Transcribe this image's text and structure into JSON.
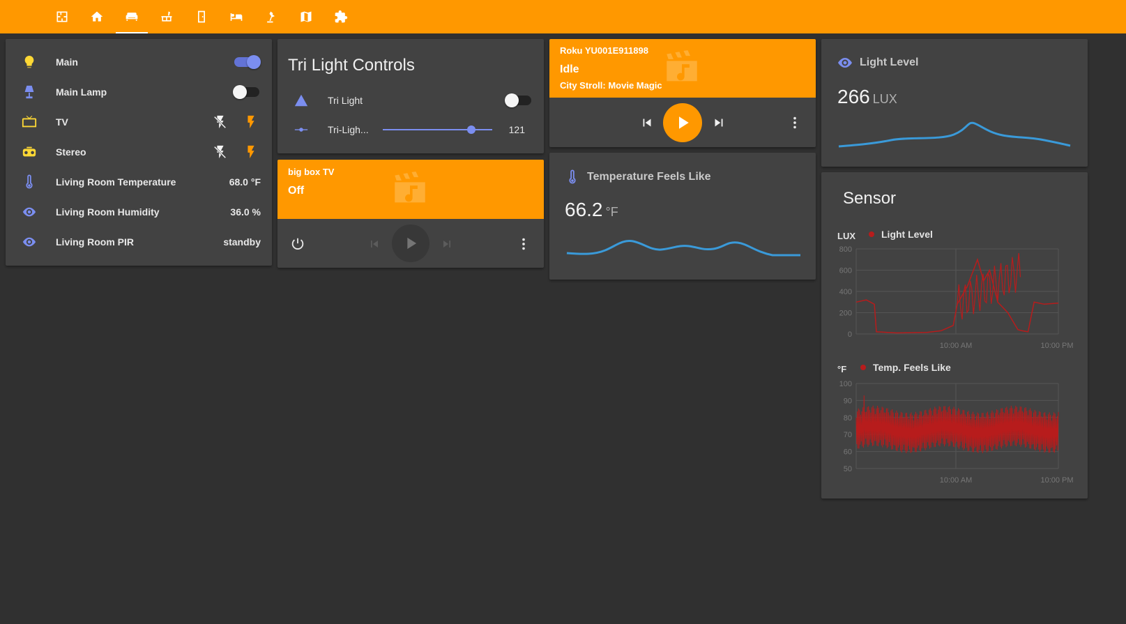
{
  "nav": {
    "tabs": [
      {
        "icon": "floorplan-icon"
      },
      {
        "icon": "home-icon"
      },
      {
        "icon": "sofa-icon",
        "active": true
      },
      {
        "icon": "kitchen-icon"
      },
      {
        "icon": "door-icon"
      },
      {
        "icon": "bed-icon"
      },
      {
        "icon": "desk-lamp-icon"
      },
      {
        "icon": "map-icon"
      },
      {
        "icon": "puzzle-icon"
      }
    ],
    "accent": "#ff9800"
  },
  "entities": {
    "rows": [
      {
        "label": "Main",
        "icon": "lightbulb-icon",
        "control": "toggle",
        "state": "on"
      },
      {
        "label": "Main Lamp",
        "icon": "lamp-icon",
        "control": "toggle",
        "state": "off"
      },
      {
        "label": "TV",
        "icon": "tv-icon",
        "control": "power-buttons"
      },
      {
        "label": "Stereo",
        "icon": "radio-icon",
        "control": "power-buttons"
      },
      {
        "label": "Living Room Temperature",
        "icon": "thermometer-icon",
        "value": "68.0 °F"
      },
      {
        "label": "Living Room Humidity",
        "icon": "eye-icon",
        "value": "36.0 %"
      },
      {
        "label": "Living Room PIR",
        "icon": "eye-icon",
        "value": "standby"
      }
    ]
  },
  "tri_light": {
    "title": "Tri Light Controls",
    "toggle_label": "Tri Light",
    "toggle_state": "off",
    "slider_label": "Tri-Ligh...",
    "slider_value": "121",
    "slider_fraction": 0.81
  },
  "big_box_tv": {
    "name": "big box TV",
    "state": "Off"
  },
  "roku": {
    "name": "Roku YU001E911898",
    "state": "Idle",
    "source": "City Stroll: Movie Magic"
  },
  "feels_like": {
    "name": "Temperature Feels Like",
    "value": "66.2",
    "unit": "°F"
  },
  "light_level": {
    "name": "Light Level",
    "value": "266",
    "unit": "LUX"
  },
  "sensor": {
    "title": "Sensor",
    "colors": {
      "series": "#b71c1c",
      "sparkline": "#3a9ad9"
    }
  },
  "chart_data": [
    {
      "type": "line",
      "unit_label": "LUX",
      "series": [
        {
          "name": "Light Level"
        }
      ],
      "ylim": [
        0,
        800
      ],
      "yticks": [
        "800",
        "600",
        "400",
        "200",
        "0"
      ],
      "xticks": [
        "10:00 AM",
        "10:00 PM"
      ],
      "x": [
        0,
        0.05,
        0.09,
        0.1,
        0.2,
        0.35,
        0.42,
        0.48,
        0.5,
        0.55,
        0.6,
        0.63,
        0.66,
        0.7,
        0.75,
        0.8,
        0.82,
        0.85,
        0.88,
        0.93,
        1.0
      ],
      "values": [
        300,
        320,
        280,
        20,
        10,
        15,
        30,
        80,
        280,
        450,
        700,
        500,
        600,
        300,
        200,
        40,
        30,
        20,
        300,
        280,
        290
      ]
    },
    {
      "type": "line",
      "unit_label": "°F",
      "series": [
        {
          "name": "Temp. Feels Like"
        }
      ],
      "ylim": [
        50,
        100
      ],
      "yticks": [
        "100",
        "90",
        "80",
        "70",
        "60",
        "50"
      ],
      "xticks": [
        "10:00 AM",
        "10:00 PM"
      ]
    }
  ]
}
